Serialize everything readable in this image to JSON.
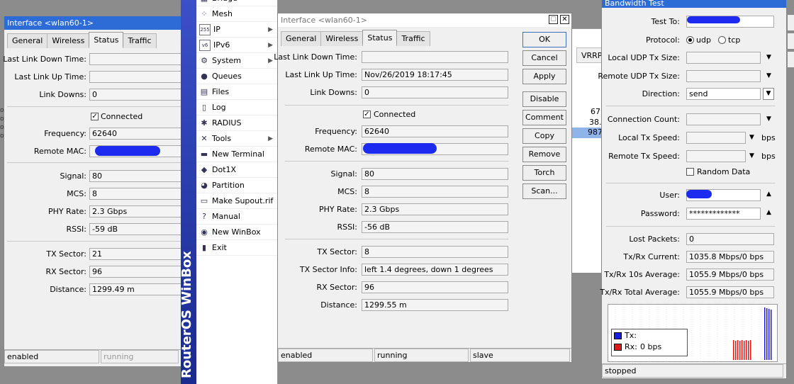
{
  "left_window": {
    "title": "Interface <wlan60-1>",
    "tabs": [
      "General",
      "Wireless",
      "Status",
      "Traffic"
    ],
    "fields": {
      "last_link_down_time": {
        "label": "Last Link Down Time:",
        "value": ""
      },
      "last_link_up_time": {
        "label": "Last Link Up Time:",
        "value": ""
      },
      "link_downs": {
        "label": "Link Downs:",
        "value": "0"
      },
      "connected": {
        "label": "Connected"
      },
      "frequency": {
        "label": "Frequency:",
        "value": "62640"
      },
      "remote_mac": {
        "label": "Remote MAC:",
        "value": ""
      },
      "signal": {
        "label": "Signal:",
        "value": "80"
      },
      "mcs": {
        "label": "MCS:",
        "value": "8"
      },
      "phy_rate": {
        "label": "PHY Rate:",
        "value": "2.3 Gbps"
      },
      "rssi": {
        "label": "RSSI:",
        "value": "-59 dB"
      },
      "tx_sector": {
        "label": "TX Sector:",
        "value": "21"
      },
      "rx_sector": {
        "label": "RX Sector:",
        "value": "96"
      },
      "distance": {
        "label": "Distance:",
        "value": "1299.49 m"
      }
    },
    "status": [
      "enabled",
      "running"
    ]
  },
  "menu": {
    "items": [
      {
        "label": "Bridge",
        "icon": "bridge-icon",
        "glyph": "▦",
        "submenu": false
      },
      {
        "label": "Mesh",
        "icon": "mesh-icon",
        "glyph": "⁘",
        "submenu": false
      },
      {
        "label": "IP",
        "icon": "ip-icon",
        "glyph": "255",
        "submenu": true
      },
      {
        "label": "IPv6",
        "icon": "ipv6-icon",
        "glyph": "v6",
        "submenu": true
      },
      {
        "label": "System",
        "icon": "system-icon",
        "glyph": "⚙",
        "submenu": true
      },
      {
        "label": "Queues",
        "icon": "queues-icon",
        "glyph": "●",
        "submenu": false
      },
      {
        "label": "Files",
        "icon": "files-icon",
        "glyph": "▤",
        "submenu": false
      },
      {
        "label": "Log",
        "icon": "log-icon",
        "glyph": "▯",
        "submenu": false
      },
      {
        "label": "RADIUS",
        "icon": "radius-icon",
        "glyph": "✱",
        "submenu": false
      },
      {
        "label": "Tools",
        "icon": "tools-icon",
        "glyph": "✕",
        "submenu": true
      },
      {
        "label": "New Terminal",
        "icon": "terminal-icon",
        "glyph": "▬",
        "submenu": false
      },
      {
        "label": "Dot1X",
        "icon": "dot1x-icon",
        "glyph": "◆",
        "submenu": false
      },
      {
        "label": "Partition",
        "icon": "partition-icon",
        "glyph": "◕",
        "submenu": false
      },
      {
        "label": "Make Supout.rif",
        "icon": "supout-icon",
        "glyph": "▭",
        "submenu": false
      },
      {
        "label": "Manual",
        "icon": "manual-icon",
        "glyph": "?",
        "submenu": false
      },
      {
        "label": "New WinBox",
        "icon": "winbox-icon",
        "glyph": "◉",
        "submenu": false
      },
      {
        "label": "Exit",
        "icon": "exit-icon",
        "glyph": "▮",
        "submenu": false
      }
    ],
    "brand": "RouterOS WinBox"
  },
  "main_window": {
    "title": "Interface <wlan60-1>",
    "tabs": [
      "General",
      "Wireless",
      "Status",
      "Traffic"
    ],
    "fields": {
      "last_link_down_time": {
        "label": "Last Link Down Time:",
        "value": ""
      },
      "last_link_up_time": {
        "label": "Last Link Up Time:",
        "value": "Nov/26/2019 18:17:45"
      },
      "link_downs": {
        "label": "Link Downs:",
        "value": "0"
      },
      "connected": {
        "label": "Connected"
      },
      "frequency": {
        "label": "Frequency:",
        "value": "62640"
      },
      "remote_mac": {
        "label": "Remote MAC:",
        "value": ""
      },
      "signal": {
        "label": "Signal:",
        "value": "80"
      },
      "mcs": {
        "label": "MCS:",
        "value": "8"
      },
      "phy_rate": {
        "label": "PHY Rate:",
        "value": "2.3 Gbps"
      },
      "rssi": {
        "label": "RSSI:",
        "value": "-56 dB"
      },
      "tx_sector": {
        "label": "TX Sector:",
        "value": "8"
      },
      "tx_sector_info": {
        "label": "TX Sector Info:",
        "value": "left 1.4 degrees, down 1 degrees"
      },
      "rx_sector": {
        "label": "RX Sector:",
        "value": "96"
      },
      "distance": {
        "label": "Distance:",
        "value": "1299.55 m"
      }
    },
    "buttons": {
      "ok": "OK",
      "cancel": "Cancel",
      "apply": "Apply",
      "disable": "Disable",
      "comment": "Comment",
      "copy": "Copy",
      "remove": "Remove",
      "torch": "Torch",
      "scan": "Scan..."
    },
    "status": [
      "enabled",
      "running",
      "slave"
    ]
  },
  "background_list": {
    "column": "VRRP",
    "values": [
      "67",
      "38.",
      "987"
    ],
    "left_marks": [
      "op",
      "op",
      "op",
      "op"
    ]
  },
  "bandwidth_test": {
    "title": "Bandwidth Test",
    "test_to": {
      "label": "Test To:",
      "value": ""
    },
    "protocol": {
      "label": "Protocol:",
      "options": [
        "udp",
        "tcp"
      ],
      "selected": "udp"
    },
    "local_udp_tx_size": {
      "label": "Local UDP Tx Size:",
      "value": ""
    },
    "remote_udp_tx_size": {
      "label": "Remote UDP Tx Size:",
      "value": ""
    },
    "direction": {
      "label": "Direction:",
      "value": "send"
    },
    "connection_count": {
      "label": "Connection Count:",
      "value": ""
    },
    "local_tx_speed": {
      "label": "Local Tx Speed:",
      "value": "",
      "unit": "bps"
    },
    "remote_tx_speed": {
      "label": "Remote Tx Speed:",
      "value": "",
      "unit": "bps"
    },
    "random_data": {
      "label": "Random Data"
    },
    "user": {
      "label": "User:",
      "value": ""
    },
    "password": {
      "label": "Password:",
      "value": "*************"
    },
    "lost_packets": {
      "label": "Lost Packets:",
      "value": "0"
    },
    "txrx_current": {
      "label": "Tx/Rx Current:",
      "value": "1035.8 Mbps/0 bps"
    },
    "txrx_10s": {
      "label": "Tx/Rx 10s Average:",
      "value": "1055.9 Mbps/0 bps"
    },
    "txrx_total": {
      "label": "Tx/Rx Total Average:",
      "value": "1055.9 Mbps/0 bps"
    },
    "legend": {
      "tx": "Tx:",
      "rx": "Rx:",
      "rx_value": "0 bps"
    },
    "status": "stopped",
    "colors": {
      "tx": "#1a1ae6",
      "rx": "#e01818"
    }
  }
}
